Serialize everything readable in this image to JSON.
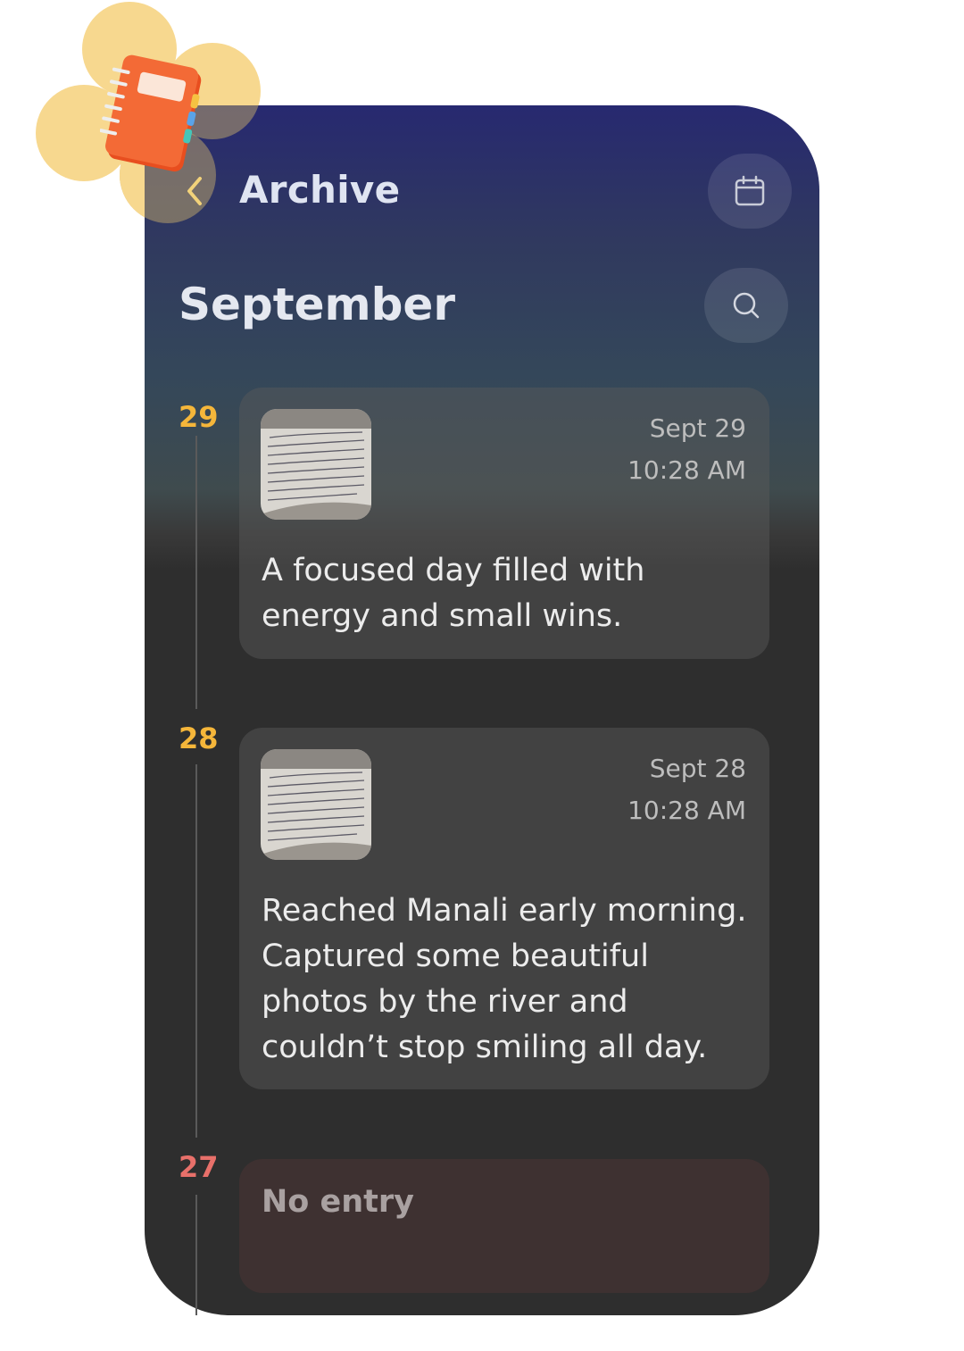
{
  "header": {
    "title": "Archive"
  },
  "month": "September",
  "icons": {
    "back": "chevron-left-icon",
    "calendar": "calendar-icon",
    "search": "search-icon",
    "logo": "notebook-icon"
  },
  "colors": {
    "accent": "#f5b63a",
    "missed": "#e8706a",
    "text": "#e5e8f0"
  },
  "days": [
    {
      "day": "29",
      "date": "Sept 29",
      "time": "10:28 AM",
      "text_lines": [
        "A focused day filled with",
        "energy and small wins."
      ]
    },
    {
      "day": "28",
      "date": "Sept 28",
      "time": "10:28 AM",
      "text_lines": [
        "Reached Manali early morning.",
        "Captured some beautiful",
        "photos by the river and",
        "couldn’t stop smiling all day."
      ]
    },
    {
      "day": "27",
      "empty_label": "No entry"
    }
  ]
}
